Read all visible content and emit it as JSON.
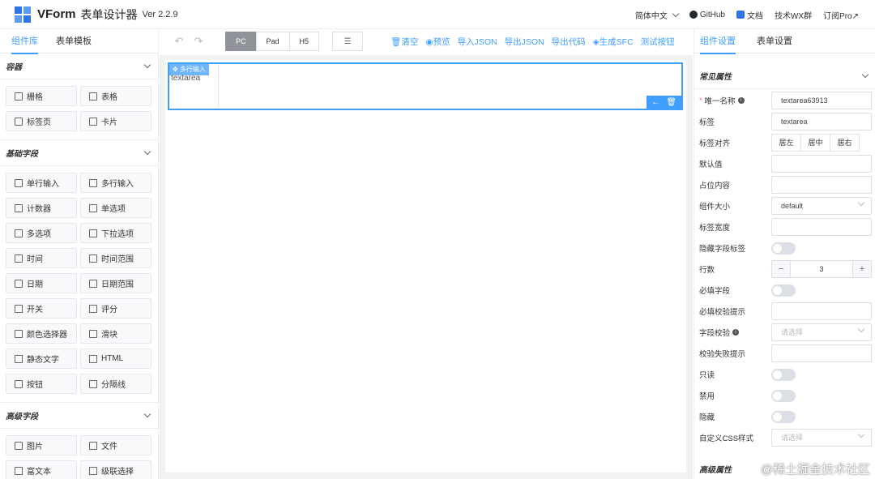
{
  "header": {
    "brand": "VForm",
    "brand_sub": "表单设计器",
    "version": "Ver 2.2.9",
    "language": "简体中文",
    "links": [
      "GitHub",
      "文档",
      "技术WX群",
      "订阅Pro↗"
    ]
  },
  "left_panel": {
    "tabs": [
      "组件库",
      "表单模板"
    ],
    "sections": [
      {
        "title": "容器",
        "items": [
          "栅格",
          "表格",
          "标签页",
          "卡片"
        ]
      },
      {
        "title": "基础字段",
        "items": [
          "单行输入",
          "多行输入",
          "计数器",
          "单选项",
          "多选项",
          "下拉选项",
          "时间",
          "时间范围",
          "日期",
          "日期范围",
          "开关",
          "评分",
          "颜色选择器",
          "滑块",
          "静态文字",
          "HTML",
          "按钮",
          "分隔线"
        ]
      },
      {
        "title": "高级字段",
        "items": [
          "图片",
          "文件",
          "富文本",
          "级联选择"
        ]
      }
    ]
  },
  "toolbar": {
    "devices": [
      "PC",
      "Pad",
      "H5"
    ],
    "actions": [
      "清空",
      "预览",
      "导入JSON",
      "导出JSON",
      "导出代码",
      "生成SFC",
      "测试按钮"
    ]
  },
  "canvas": {
    "field_tag": "多行输入",
    "field_label": "textarea"
  },
  "right_panel": {
    "tabs": [
      "组件设置",
      "表单设置"
    ],
    "section_title": "常见属性",
    "props": {
      "name_label": "唯一名称",
      "name_value": "textarea63913",
      "label_label": "标签",
      "label_value": "textarea",
      "align_label": "标签对齐",
      "align_options": [
        "居左",
        "居中",
        "居右"
      ],
      "default_label": "默认值",
      "placeholder_label": "占位内容",
      "size_label": "组件大小",
      "size_value": "default",
      "width_label": "标签宽度",
      "hide_label_label": "隐藏字段标签",
      "rows_label": "行数",
      "rows_value": "3",
      "required_label": "必填字段",
      "required_hint_label": "必填校验提示",
      "validation_label": "字段校验",
      "validation_placeholder": "请选择",
      "validation_fail_label": "校验失败提示",
      "readonly_label": "只读",
      "disabled_label": "禁用",
      "hidden_label": "隐藏",
      "css_label": "自定义CSS样式",
      "css_placeholder": "请选择"
    },
    "advanced_title": "高级属性"
  },
  "watermark": "@稀土掘金技术社区"
}
